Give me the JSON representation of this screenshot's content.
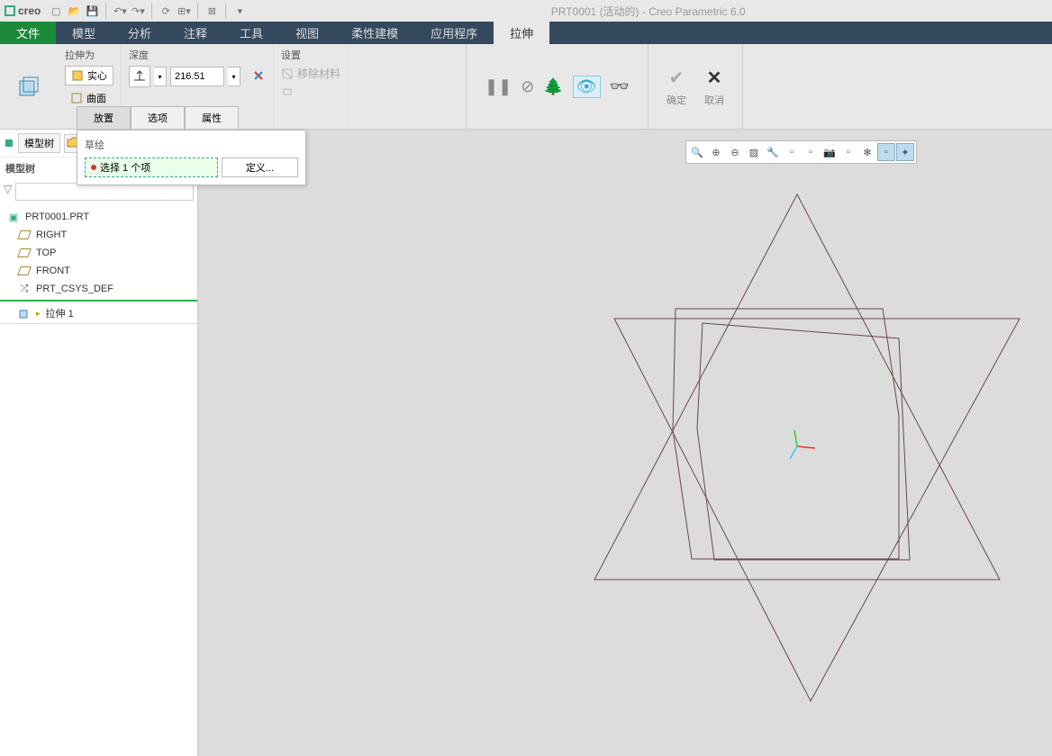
{
  "app": {
    "name": "creo",
    "title": "PRT0001 (活动的) - Creo Parametric 6.0"
  },
  "menu": {
    "file": "文件",
    "tabs": [
      "模型",
      "分析",
      "注释",
      "工具",
      "视图",
      "柔性建模",
      "应用程序",
      "拉伸"
    ],
    "active": "拉伸"
  },
  "ribbon": {
    "extrude_as": {
      "title": "拉伸为",
      "solid": "实心",
      "surface": "曲面"
    },
    "depth": {
      "title": "深度",
      "value": "216.51"
    },
    "settings": {
      "title": "设置",
      "remove_mat": "移除材料"
    },
    "ok": "确定",
    "cancel": "取消",
    "dash_tabs": [
      "放置",
      "选项",
      "属性"
    ]
  },
  "sidebar": {
    "tab_label": "模型树",
    "title": "模型树",
    "root": "PRT0001.PRT",
    "items": [
      "RIGHT",
      "TOP",
      "FRONT",
      "PRT_CSYS_DEF"
    ],
    "feature": "拉伸 1"
  },
  "sketch_panel": {
    "title": "草绘",
    "select_text": "选择 1 个项",
    "define": "定义..."
  }
}
